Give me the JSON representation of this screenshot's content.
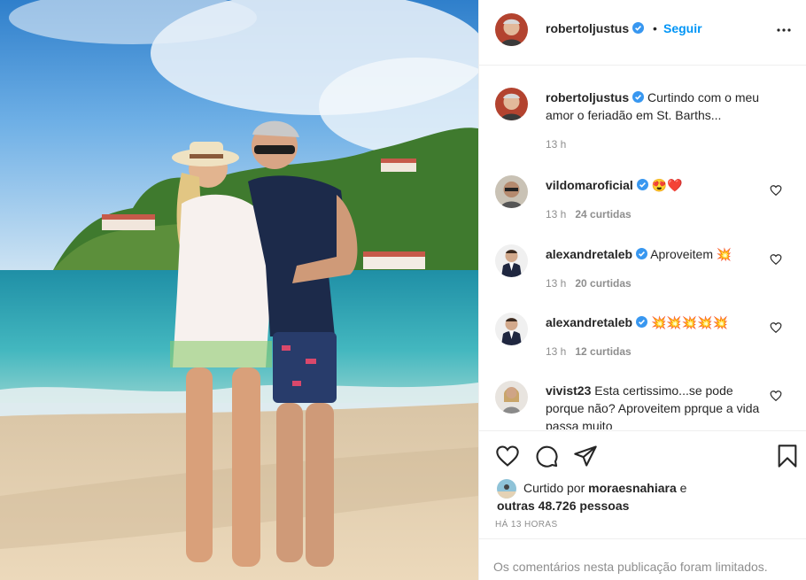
{
  "post": {
    "author": "robertoljustus",
    "dot": "•",
    "follow_label": "Seguir",
    "more_icon": "more-options-icon",
    "caption": "Curtindo com o meu amor o feriadão em St. Barths...",
    "caption_time": "13 h"
  },
  "comments": [
    {
      "user": "vildomaroficial",
      "verified": true,
      "text": "😍❤️",
      "time": "13 h",
      "likes": "24 curtidas"
    },
    {
      "user": "alexandretaleb",
      "verified": true,
      "text": "Aproveitem 💥",
      "time": "13 h",
      "likes": "20 curtidas"
    },
    {
      "user": "alexandretaleb",
      "verified": true,
      "text": "💥💥💥💥💥",
      "time": "13 h",
      "likes": "12 curtidas"
    },
    {
      "user": "vivist23",
      "verified": false,
      "text": "Esta certissimo...se pode porque não? Aproveitem pprque a vida passa muito",
      "time": "",
      "likes": ""
    }
  ],
  "actions": {
    "like_icon": "heart-icon",
    "comment_icon": "comment-icon",
    "share_icon": "share-icon",
    "save_icon": "bookmark-icon"
  },
  "likes": {
    "prefix": "Curtido por",
    "user": "moraesnahiara",
    "suffix": "e",
    "others": "outras 48.726 pessoas"
  },
  "timestamp": "HÁ 13 HORAS",
  "comments_limited": "Os comentários nesta publicação foram limitados.",
  "colors": {
    "link_blue": "#0095f6",
    "verified_blue": "#3897f0",
    "muted_text": "#8e8e8e",
    "border": "#efefef"
  }
}
